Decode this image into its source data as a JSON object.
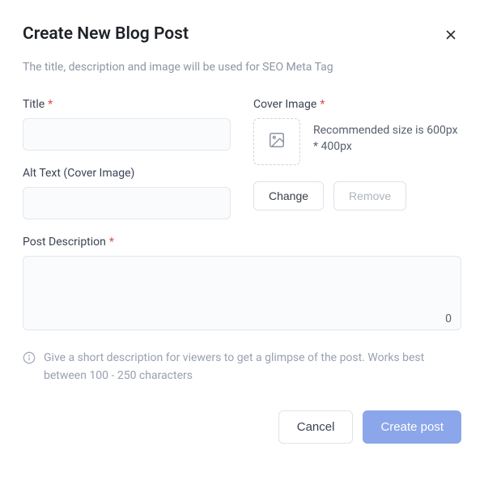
{
  "header": {
    "title": "Create New Blog Post",
    "subtitle": "The title, description and image will be used for SEO Meta Tag"
  },
  "title_field": {
    "label": "Title",
    "value": ""
  },
  "cover": {
    "label": "Cover Image",
    "hint": "Recommended size is 600px * 400px",
    "change_label": "Change",
    "remove_label": "Remove"
  },
  "alt_text": {
    "label": "Alt Text (Cover Image)",
    "value": ""
  },
  "description": {
    "label": "Post Description",
    "value": "",
    "count": "0",
    "hint": "Give a short description for viewers to get a glimpse of the post. Works best between 100 - 250 characters"
  },
  "footer": {
    "cancel_label": "Cancel",
    "submit_label": "Create post"
  }
}
